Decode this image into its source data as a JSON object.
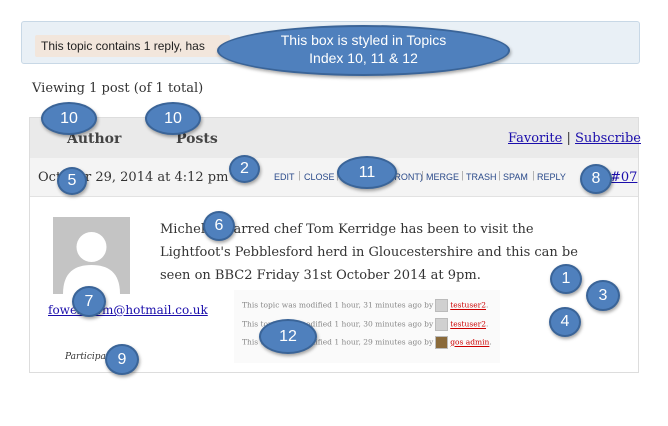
{
  "notice": {
    "text": "This topic contains 1 reply, has"
  },
  "callout": {
    "line1": "This  box is styled in Topics",
    "line2": "Index 10, 11 & 12"
  },
  "pagination": {
    "text": "Viewing 1 post (of 1 total)"
  },
  "header": {
    "author_label": "Author",
    "posts_label": "Posts",
    "favorite_label": "Favorite",
    "separator": "|",
    "subscribe_label": "Subscribe"
  },
  "meta": {
    "date": "October 29, 2014 at 4:12 pm",
    "permalink": "#07",
    "admin_links": [
      "EDIT",
      "CLOSE",
      "STICK (TO FRONT)",
      "MERGE",
      "TRASH",
      "SPAM",
      "REPLY"
    ]
  },
  "author": {
    "email": "fowellfarm@hotmail.co.uk",
    "role": "Participant"
  },
  "post": {
    "content": "Michelin starred chef Tom Kerridge has been to visit the Lightfoot's Pebblesford herd in Gloucestershire and this can be seen on BBC2 Friday 31st October 2014 at 9pm."
  },
  "revisions": [
    {
      "prefix": "This topic was modified 1 hour, 31 minutes ago by",
      "user": "testuser2"
    },
    {
      "prefix": "This topic was modified 1 hour, 30 minutes ago by",
      "user": "testuser2"
    },
    {
      "prefix": "This topic was modified 1 hour, 29 minutes ago by",
      "user": "gos admin"
    }
  ],
  "markers": [
    "10",
    "10",
    "2",
    "11",
    "5",
    "8",
    "6",
    "1",
    "3",
    "7",
    "4",
    "12",
    "9"
  ],
  "colors": {
    "marker": "#4f80bd",
    "link": "#1a0dab",
    "notice_bg": "#e9f0f6",
    "user_link": "#cc0000"
  }
}
